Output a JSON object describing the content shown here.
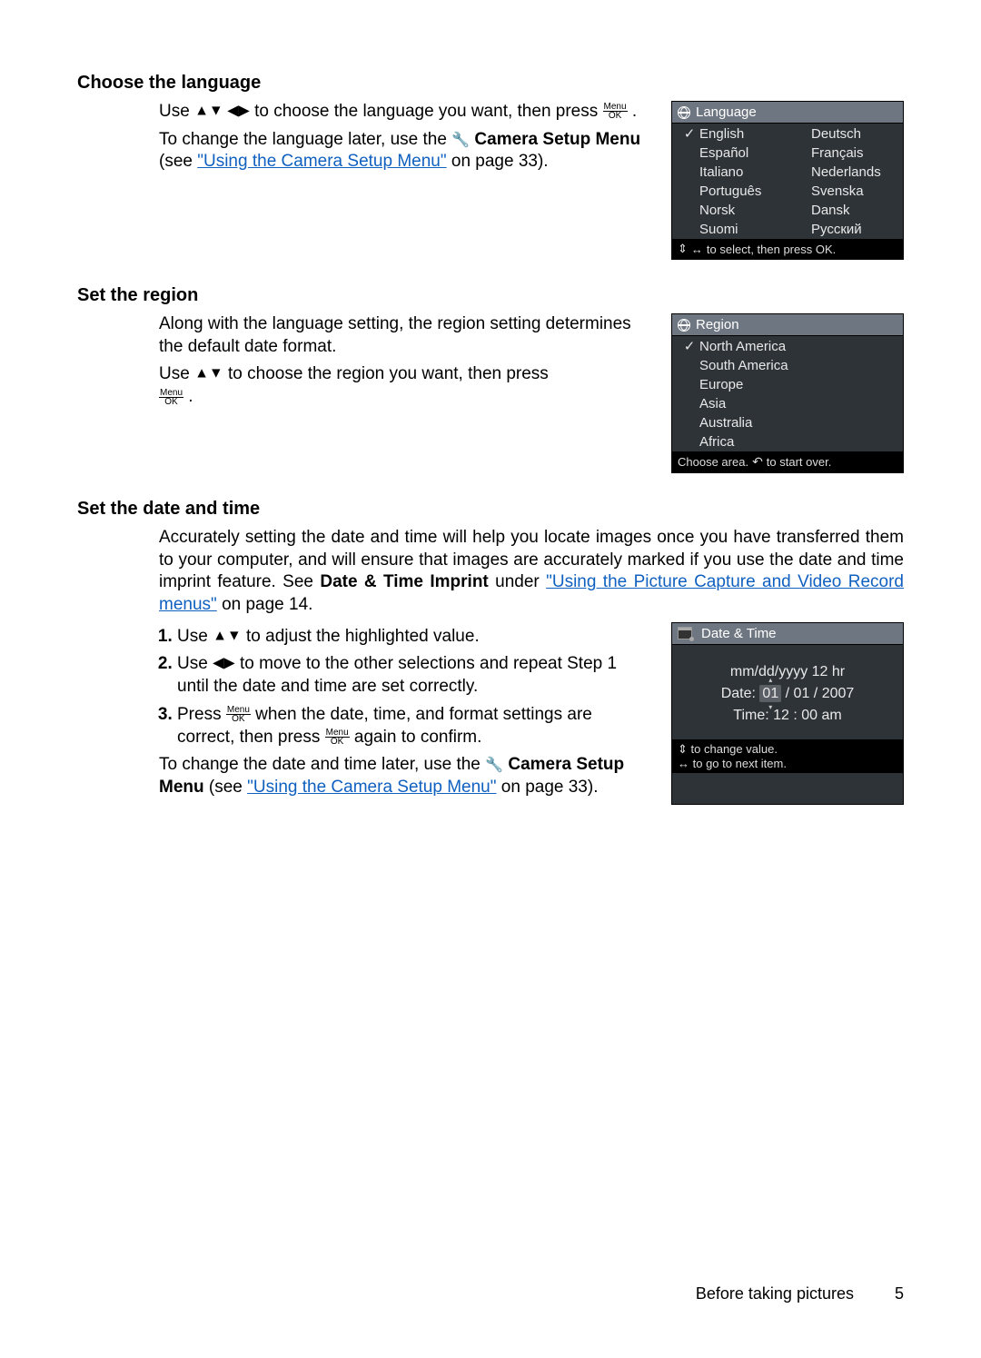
{
  "sections": {
    "language": {
      "title": "Choose the language",
      "p1a": "Use ",
      "p1b": " to choose the language you want, then press ",
      "p1c": ".",
      "p2a": "To change the language later, use the ",
      "p2b": " Camera Setup Menu",
      "p2c": " (see ",
      "link": "\"Using the Camera Setup Menu\"",
      "p2d": " on page 33)."
    },
    "region": {
      "title": "Set the region",
      "p1": "Along with the language setting, the region setting determines the default date format.",
      "p2a": "Use ",
      "p2b": " to choose the region you want, then press ",
      "p2c": "."
    },
    "datetime": {
      "title": "Set the date and time",
      "p1a": "Accurately setting the date and time will help you locate images once you have transferred them to your computer, and will ensure that images are accurately marked if you use the date and time imprint feature. See ",
      "p1bold": "Date & Time Imprint",
      "p1b": " under ",
      "link1": "\"Using the Picture Capture and Video Record menus\"",
      "p1c": " on page 14.",
      "steps": [
        "Use ▲▼ to adjust the highlighted value.",
        "Use ◀▶ to move to the other selections and repeat Step 1 until the date and time are set correctly.",
        "Press Menu/OK when the date, time, and format settings are correct, then press Menu/OK again to confirm."
      ],
      "step1a": "Use ",
      "step1b": " to adjust the highlighted value.",
      "step2a": "Use ",
      "step2b": " to move to the other selections and repeat Step 1 until the date and time are set correctly.",
      "step3a": "Press ",
      "step3b": " when the date, time, and format settings are correct, then press ",
      "step3c": " again to confirm.",
      "p2a": "To change the date and time later, use the ",
      "p2b": " Camera Setup Menu",
      "p2c": " (see ",
      "link2": "\"Using the Camera Setup Menu\"",
      "p2d": " on page 33)."
    }
  },
  "screens": {
    "language": {
      "title": "Language",
      "items_left": [
        "English",
        "Español",
        "Italiano",
        "Português",
        "Norsk",
        "Suomi"
      ],
      "items_right": [
        "Deutsch",
        "Français",
        "Nederlands",
        "Svenska",
        "Dansk",
        "Русский"
      ],
      "selected_index": 0,
      "footer_a": "to select, then press OK."
    },
    "region": {
      "title": "Region",
      "items": [
        "North America",
        "South America",
        "Europe",
        "Asia",
        "Australia",
        "Africa"
      ],
      "selected_index": 0,
      "footer_a": "Choose area. ",
      "footer_b": " to start over."
    },
    "datetime": {
      "title": "Date & Time",
      "format": "mm/dd/yyyy  12 hr",
      "date_label": "Date:",
      "date_hl": "01",
      "date_rest": " / 01 / 2007",
      "time_label": "Time:",
      "time_value": "12 : 00  am",
      "footer_a": "to change value.",
      "footer_b": "to go to next item."
    }
  },
  "glyphs": {
    "updown": "▲▼",
    "leftright": "◀▶",
    "updown_leftright": "▲▼ ◀▶",
    "updown_alt": "⇕",
    "leftright_alt": "↔",
    "check": "✓",
    "wrench": "🔧",
    "undo": "↶"
  },
  "footer": {
    "text": "Before taking pictures",
    "page": "5"
  },
  "menuok": {
    "top": "Menu",
    "bot": "OK"
  }
}
